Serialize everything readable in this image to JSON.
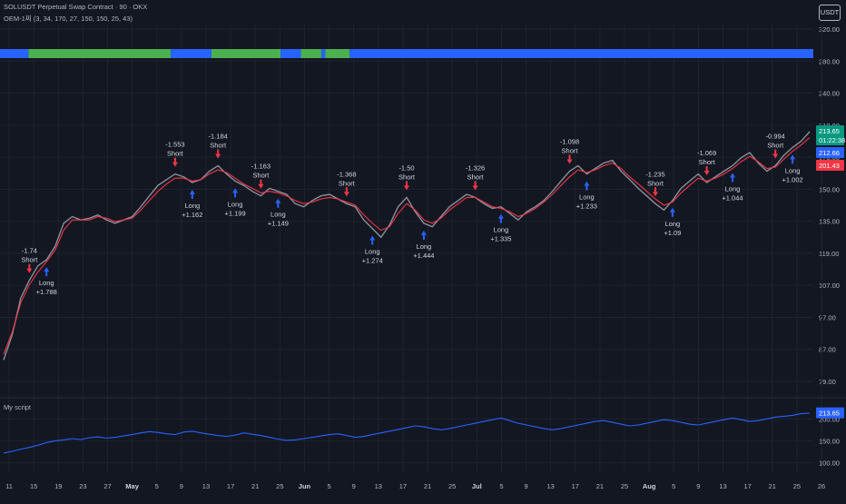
{
  "header": {
    "symbol_line": "SOLUSDT Perpetual Swap Contract · 90 · OKX",
    "indicator_line": "OEM-1찌 (3, 34, 170, 27, 150, 150, 25, 43)",
    "lower_pane_title": "My script",
    "currency_button": "USDT"
  },
  "colors": {
    "background": "#131722",
    "grid": "#1f2330",
    "price_line": "#8a8f99",
    "ma_line": "#f23645",
    "band_blue": "#2962ff",
    "band_green": "#4caf50",
    "long_arrow": "#2962ff",
    "short_arrow": "#f23645",
    "lower_line": "#2962ff",
    "badge_green": "#089981",
    "badge_blue": "#2962ff",
    "badge_red": "#f23645"
  },
  "chart_data": {
    "type": "line",
    "y_axis_labels": [
      "320.00",
      "280.00",
      "240.00",
      "210.00",
      "170.00",
      "150.00",
      "135.00",
      "119.00",
      "107.00",
      "97.00",
      "87.00",
      "79.00"
    ],
    "lower_y_axis_labels": [
      "200.00",
      "150.00",
      "100.00"
    ],
    "x_tick_labels": [
      "11",
      "15",
      "19",
      "23",
      "27",
      "May",
      "5",
      "9",
      "13",
      "17",
      "21",
      "25",
      "Jun",
      "5",
      "9",
      "13",
      "17",
      "21",
      "25",
      "Jul",
      "5",
      "9",
      "13",
      "17",
      "21",
      "25",
      "Aug",
      "5",
      "9",
      "13",
      "17",
      "21",
      "25",
      "26"
    ],
    "price_badges": [
      {
        "value": "213.65",
        "sub": "01:22:38",
        "color": "green"
      },
      {
        "value": "212.66",
        "color": "blue"
      },
      {
        "value": "201.43",
        "color": "red"
      }
    ],
    "lower_badge": "213.65",
    "price_series": [
      86,
      95,
      110,
      118,
      125,
      128,
      135,
      148,
      152,
      150,
      151,
      153,
      150,
      148,
      150,
      152,
      158,
      165,
      172,
      176,
      180,
      178,
      174,
      176,
      182,
      186,
      180,
      175,
      172,
      168,
      165,
      170,
      168,
      166,
      160,
      158,
      162,
      165,
      166,
      163,
      160,
      158,
      150,
      145,
      140,
      147,
      158,
      164,
      155,
      148,
      146,
      152,
      158,
      162,
      166,
      164,
      160,
      157,
      158,
      154,
      150,
      155,
      158,
      162,
      168,
      175,
      182,
      186,
      180,
      184,
      188,
      190,
      182,
      176,
      170,
      165,
      160,
      156,
      162,
      170,
      175,
      180,
      174,
      178,
      182,
      186,
      192,
      196,
      188,
      182,
      186,
      194,
      200,
      205,
      213
    ],
    "ma_series": [
      88,
      96,
      108,
      116,
      122,
      127,
      133,
      144,
      150,
      150,
      150,
      152,
      151,
      149,
      150,
      151,
      156,
      162,
      168,
      173,
      177,
      177,
      175,
      176,
      180,
      183,
      181,
      177,
      173,
      170,
      167,
      168,
      167,
      165,
      162,
      160,
      161,
      163,
      164,
      163,
      161,
      159,
      153,
      148,
      144,
      146,
      154,
      160,
      156,
      150,
      148,
      151,
      156,
      160,
      164,
      164,
      161,
      158,
      157,
      155,
      152,
      154,
      157,
      161,
      166,
      172,
      178,
      183,
      181,
      183,
      186,
      188,
      184,
      178,
      173,
      168,
      163,
      159,
      161,
      167,
      172,
      177,
      175,
      177,
      180,
      184,
      189,
      193,
      189,
      184,
      185,
      191,
      197,
      202,
      208
    ],
    "lower_series": [
      122,
      126,
      131,
      135,
      140,
      146,
      150,
      152,
      155,
      153,
      157,
      159,
      156,
      158,
      161,
      164,
      168,
      171,
      169,
      166,
      164,
      170,
      172,
      168,
      165,
      162,
      160,
      163,
      168,
      165,
      162,
      158,
      154,
      151,
      152,
      155,
      158,
      161,
      164,
      166,
      162,
      158,
      160,
      164,
      168,
      172,
      176,
      180,
      184,
      182,
      178,
      175,
      178,
      182,
      186,
      190,
      194,
      198,
      202,
      196,
      190,
      186,
      182,
      178,
      175,
      178,
      182,
      186,
      190,
      194,
      196,
      192,
      188,
      184,
      186,
      190,
      194,
      198,
      196,
      192,
      188,
      186,
      190,
      194,
      198,
      202,
      198,
      194,
      196,
      200,
      204,
      206,
      208,
      212,
      213
    ],
    "band_segments": [
      {
        "from": 0.0,
        "to": 0.035,
        "color": "blue"
      },
      {
        "from": 0.035,
        "to": 0.21,
        "color": "green"
      },
      {
        "from": 0.21,
        "to": 0.26,
        "color": "blue"
      },
      {
        "from": 0.26,
        "to": 0.345,
        "color": "green"
      },
      {
        "from": 0.345,
        "to": 0.37,
        "color": "blue"
      },
      {
        "from": 0.37,
        "to": 0.395,
        "color": "green"
      },
      {
        "from": 0.395,
        "to": 0.4,
        "color": "blue"
      },
      {
        "from": 0.4,
        "to": 0.43,
        "color": "green"
      },
      {
        "from": 0.43,
        "to": 1.0,
        "color": "blue"
      }
    ],
    "signals": [
      {
        "i": 3,
        "type": "short",
        "labels": [
          "-1.74",
          "Short"
        ]
      },
      {
        "i": 5,
        "type": "long",
        "labels": [
          "Long",
          "+1.788"
        ]
      },
      {
        "i": 20,
        "type": "short",
        "labels": [
          "-1.553",
          "Short"
        ]
      },
      {
        "i": 22,
        "type": "long",
        "labels": [
          "Long",
          "+1.162"
        ]
      },
      {
        "i": 25,
        "type": "short",
        "labels": [
          "-1.184",
          "Short"
        ]
      },
      {
        "i": 27,
        "type": "long",
        "labels": [
          "Long",
          "+1.199"
        ]
      },
      {
        "i": 30,
        "type": "short",
        "labels": [
          "-1.163",
          "Short"
        ]
      },
      {
        "i": 32,
        "type": "long",
        "labels": [
          "Long",
          "+1.149"
        ]
      },
      {
        "i": 40,
        "type": "short",
        "labels": [
          "-1.368",
          "Short"
        ]
      },
      {
        "i": 43,
        "type": "long",
        "labels": [
          "Long",
          "+1.274"
        ]
      },
      {
        "i": 47,
        "type": "short",
        "labels": [
          "-1.50",
          "Short"
        ]
      },
      {
        "i": 49,
        "type": "long",
        "labels": [
          "Long",
          "+1.444"
        ]
      },
      {
        "i": 55,
        "type": "short",
        "labels": [
          "-1.326",
          "Short"
        ]
      },
      {
        "i": 58,
        "type": "long",
        "labels": [
          "Long",
          "+1.335"
        ]
      },
      {
        "i": 66,
        "type": "short",
        "labels": [
          "-1.098",
          "Short"
        ]
      },
      {
        "i": 68,
        "type": "long",
        "labels": [
          "Long",
          "+1.233"
        ]
      },
      {
        "i": 76,
        "type": "short",
        "labels": [
          "-1.235",
          "Short"
        ]
      },
      {
        "i": 78,
        "type": "long",
        "labels": [
          "Long",
          "+1.09"
        ]
      },
      {
        "i": 82,
        "type": "short",
        "labels": [
          "-1.069",
          "Short"
        ]
      },
      {
        "i": 85,
        "type": "long",
        "labels": [
          "Long",
          "+1.044"
        ]
      },
      {
        "i": 90,
        "type": "short",
        "labels": [
          "-0.994",
          "Short"
        ]
      },
      {
        "i": 92,
        "type": "long",
        "labels": [
          "Long",
          "+1.002"
        ]
      }
    ]
  }
}
